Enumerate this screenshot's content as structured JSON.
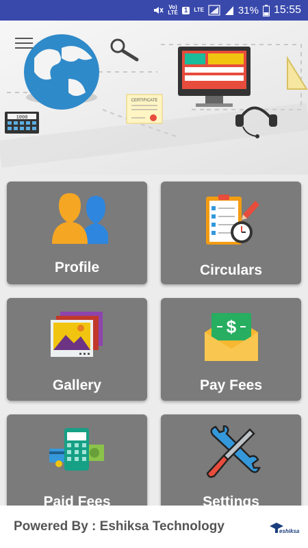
{
  "status_bar": {
    "volte_top": "Vo)",
    "volte_bottom": "LTE",
    "sim_slot": "1",
    "lte_label": "LTE",
    "battery": "31%",
    "time": "15:55"
  },
  "banner": {
    "certificate_label": "CERTIFICATE",
    "calculator_display": "1000"
  },
  "tiles": [
    {
      "label": "Profile",
      "icon": "profile-icon"
    },
    {
      "label": "Circulars",
      "icon": "circulars-icon"
    },
    {
      "label": "Gallery",
      "icon": "gallery-icon"
    },
    {
      "label": "Pay Fees",
      "icon": "pay-fees-icon"
    },
    {
      "label": "Paid Fees",
      "icon": "paid-fees-icon"
    },
    {
      "label": "Settings",
      "icon": "settings-icon"
    }
  ],
  "footer": {
    "powered_by": "Powered By : Eshiksa Technology",
    "logo_text": "eshiksa"
  },
  "colors": {
    "status_bar": "#3949ab",
    "tile": "#7b7b7b",
    "footer_text": "#555555"
  }
}
